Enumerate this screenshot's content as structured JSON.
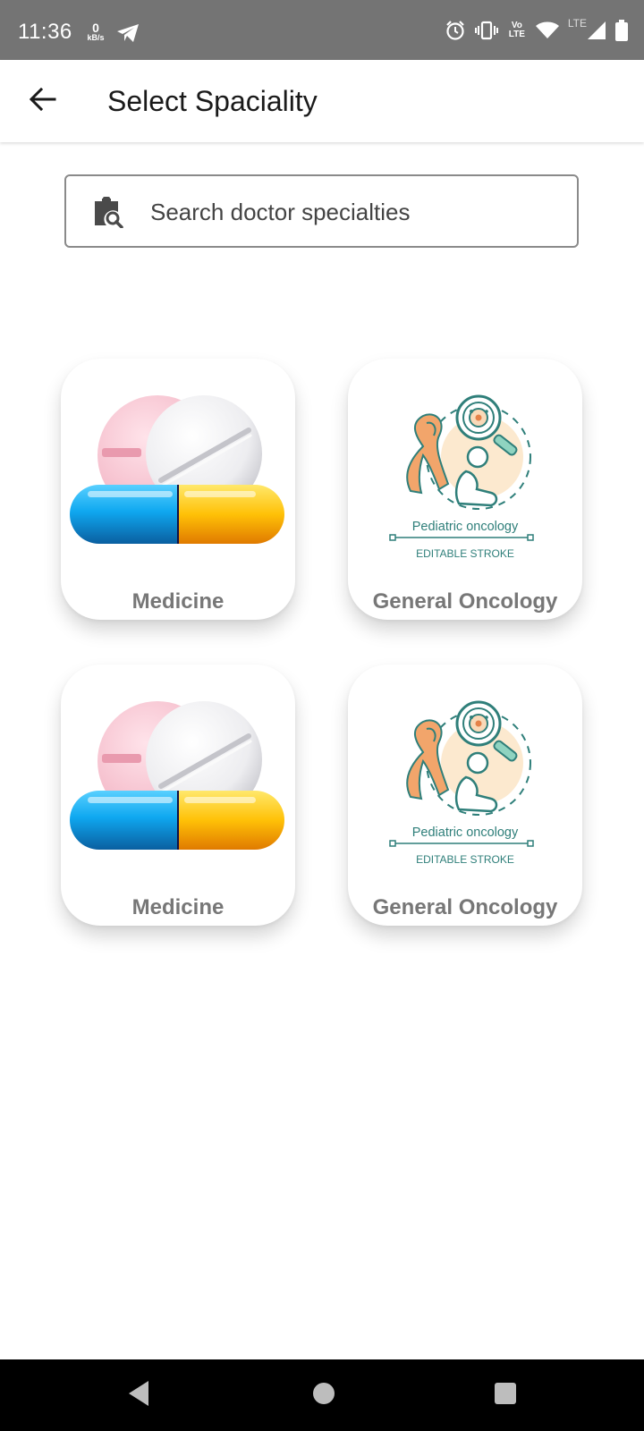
{
  "status_bar": {
    "time": "11:36",
    "net_speed_value": "0",
    "net_speed_unit": "kB/s",
    "volte_label": "Vo LTE",
    "lte_label": "LTE",
    "icons": [
      "telegram-icon",
      "alarm-icon",
      "vibrate-icon",
      "volte-icon",
      "wifi-icon",
      "signal-icon",
      "battery-icon"
    ]
  },
  "app_bar": {
    "back_icon": "arrow-left-icon",
    "title": "Select Spaciality"
  },
  "search": {
    "icon": "clipboard-search-icon",
    "placeholder": "Search doctor specialties",
    "value": ""
  },
  "specialties": [
    {
      "label": "Medicine",
      "image": "pills-capsule",
      "image_text": []
    },
    {
      "label": "General Oncology",
      "image": "pediatric-oncology",
      "image_text": [
        "Pediatric oncology",
        "EDITABLE STROKE"
      ]
    },
    {
      "label": "Medicine",
      "image": "pills-capsule",
      "image_text": []
    },
    {
      "label": "General Oncology",
      "image": "pediatric-oncology",
      "image_text": [
        "Pediatric oncology",
        "EDITABLE STROKE"
      ]
    }
  ],
  "nav_bar": {
    "icons": [
      "back-triangle-icon",
      "home-circle-icon",
      "recents-square-icon"
    ]
  },
  "colors": {
    "status_bar": "#747474",
    "card_label": "#777777",
    "oncology_ribbon": "#F2A56B",
    "oncology_teal": "#2F7F7A",
    "capsule_blue": "#0FA8F0",
    "capsule_yellow": "#FFC107",
    "tablet_pink": "#F7C9D4"
  }
}
